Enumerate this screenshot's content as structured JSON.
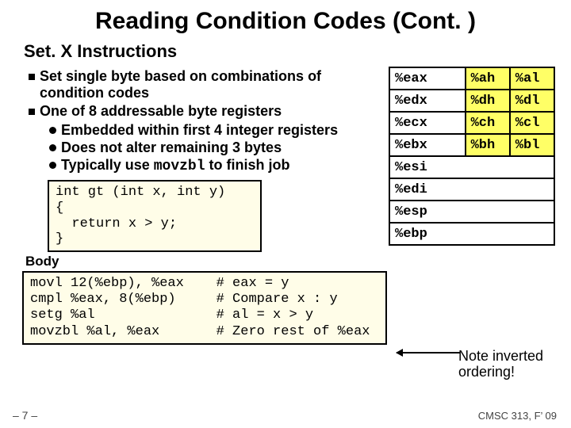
{
  "title": "Reading Condition Codes (Cont. )",
  "subtitle": "Set. X Instructions",
  "bullets": {
    "b1a": "Set single byte based on combinations of condition codes",
    "b1b": "One of 8 addressable byte registers",
    "b2a": "Embedded within first 4 integer registers",
    "b2b": "Does not alter remaining 3 bytes",
    "b2c_pre": "Typically use ",
    "b2c_mono": "movzbl",
    "b2c_post": " to finish job"
  },
  "regs": [
    [
      "%eax",
      "%ah",
      "%al"
    ],
    [
      "%edx",
      "%dh",
      "%dl"
    ],
    [
      "%ecx",
      "%ch",
      "%cl"
    ],
    [
      "%ebx",
      "%bh",
      "%bl"
    ],
    [
      "%esi",
      "",
      ""
    ],
    [
      "%edi",
      "",
      ""
    ],
    [
      "%esp",
      "",
      ""
    ],
    [
      "%ebp",
      "",
      ""
    ]
  ],
  "code_c": "int gt (int x, int y)\n{\n  return x > y;\n}",
  "body_label": "Body",
  "code_asm": "movl 12(%ebp), %eax    # eax = y\ncmpl %eax, 8(%ebp)     # Compare x : y\nsetg %al               # al = x > y\nmovzbl %al, %eax       # Zero rest of %eax",
  "note": "Note inverted ordering!",
  "footer_left": "– 7 –",
  "footer_right": "CMSC 313, F’ 09"
}
